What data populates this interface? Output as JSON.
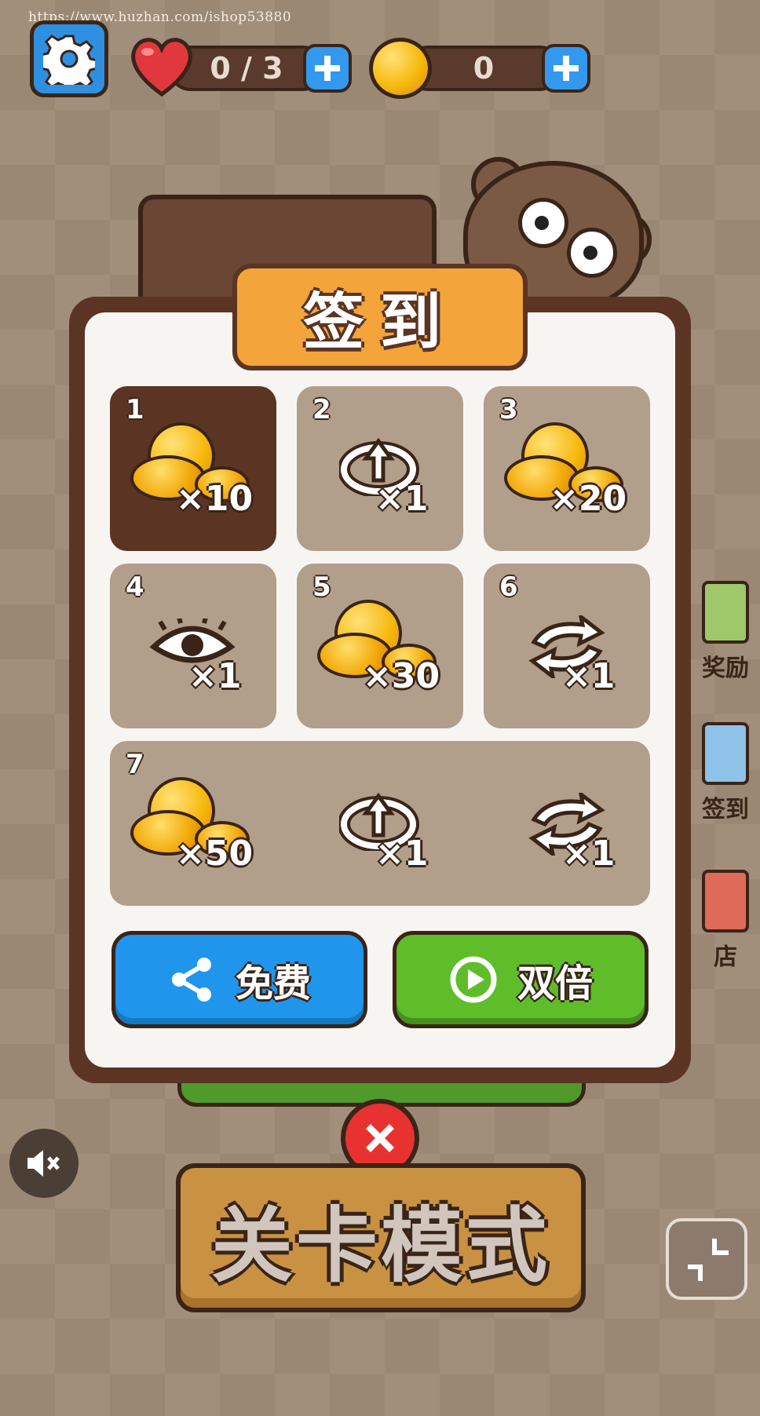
{
  "watermark": "https://www.huzhan.com/ishop53880",
  "top_bar": {
    "lives_text": "0 / 3",
    "coins_text": "0"
  },
  "dialog": {
    "title": "签到",
    "days": [
      {
        "num": "1",
        "rewards": [
          {
            "icon": "coin-icon",
            "qty": "×10"
          }
        ],
        "state": "claimed"
      },
      {
        "num": "2",
        "rewards": [
          {
            "icon": "undo-icon",
            "qty": "×1"
          }
        ]
      },
      {
        "num": "3",
        "rewards": [
          {
            "icon": "coin-icon",
            "qty": "×20"
          }
        ]
      },
      {
        "num": "4",
        "rewards": [
          {
            "icon": "eye-icon",
            "qty": "×1"
          }
        ]
      },
      {
        "num": "5",
        "rewards": [
          {
            "icon": "coin-icon",
            "qty": "×30"
          }
        ]
      },
      {
        "num": "6",
        "rewards": [
          {
            "icon": "refresh-icon",
            "qty": "×1"
          }
        ]
      },
      {
        "num": "7",
        "rewards": [
          {
            "icon": "coin-icon",
            "qty": "×50"
          },
          {
            "icon": "undo-icon",
            "qty": "×1"
          },
          {
            "icon": "refresh-icon",
            "qty": "×1"
          }
        ]
      }
    ],
    "free_button_label": "免费",
    "double_button_label": "双倍"
  },
  "side_menu": {
    "reward_label": "奖励",
    "checkin_label": "签到",
    "shop_label": "店"
  },
  "level_mode_label": "关卡模式",
  "colors": {
    "background": "#a28f7b",
    "dialog_border": "#5b3424",
    "title_tab": "#f3a43a",
    "free_button": "#1f96ec",
    "double_button": "#5fbd2a",
    "close_button": "#e83232",
    "level_button": "#c99243"
  }
}
